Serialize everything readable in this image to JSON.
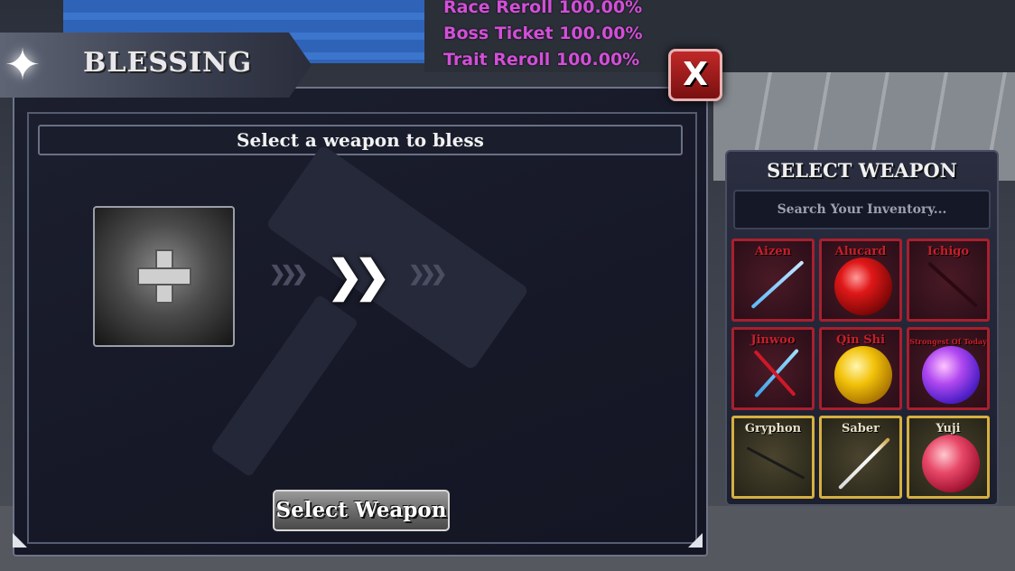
{
  "buffs": [
    "Race Reroll 100.00%",
    "Boss Ticket 100.00%",
    "Trait Reroll 100.00%"
  ],
  "header": {
    "title": "BLESSING",
    "star_icon": "four-point-star-icon"
  },
  "close_button": {
    "label": "X"
  },
  "main": {
    "instruction": "Select a weapon to bless",
    "empty_slot_icon": "plus-icon",
    "arrow_icon": "double-chevron-right-icon",
    "select_button_label": "Select Weapon"
  },
  "weapon_select": {
    "title": "SELECT WEAPON",
    "search_placeholder": "Search Your Inventory...",
    "items": [
      {
        "name": "Aizen",
        "rarity": "red",
        "icon": "katana-icon"
      },
      {
        "name": "Alucard",
        "rarity": "red",
        "icon": "red-orb-icon"
      },
      {
        "name": "Ichigo",
        "rarity": "red",
        "icon": "katana-icon"
      },
      {
        "name": "Jinwoo",
        "rarity": "red",
        "icon": "twin-daggers-icon"
      },
      {
        "name": "Qin Shi",
        "rarity": "red",
        "icon": "yellow-orb-icon"
      },
      {
        "name": "Strongest Of Today",
        "rarity": "red",
        "icon": "violet-orb-icon"
      },
      {
        "name": "Gryphon",
        "rarity": "gold",
        "icon": "rapier-icon"
      },
      {
        "name": "Saber",
        "rarity": "gold",
        "icon": "longsword-icon"
      },
      {
        "name": "Yuji",
        "rarity": "gold",
        "icon": "pink-orb-icon"
      }
    ]
  },
  "colors": {
    "rare_border": "#a8202e",
    "legendary_border": "#d6b040",
    "buff_text": "#d24fd8",
    "close_button": "#c02828"
  }
}
